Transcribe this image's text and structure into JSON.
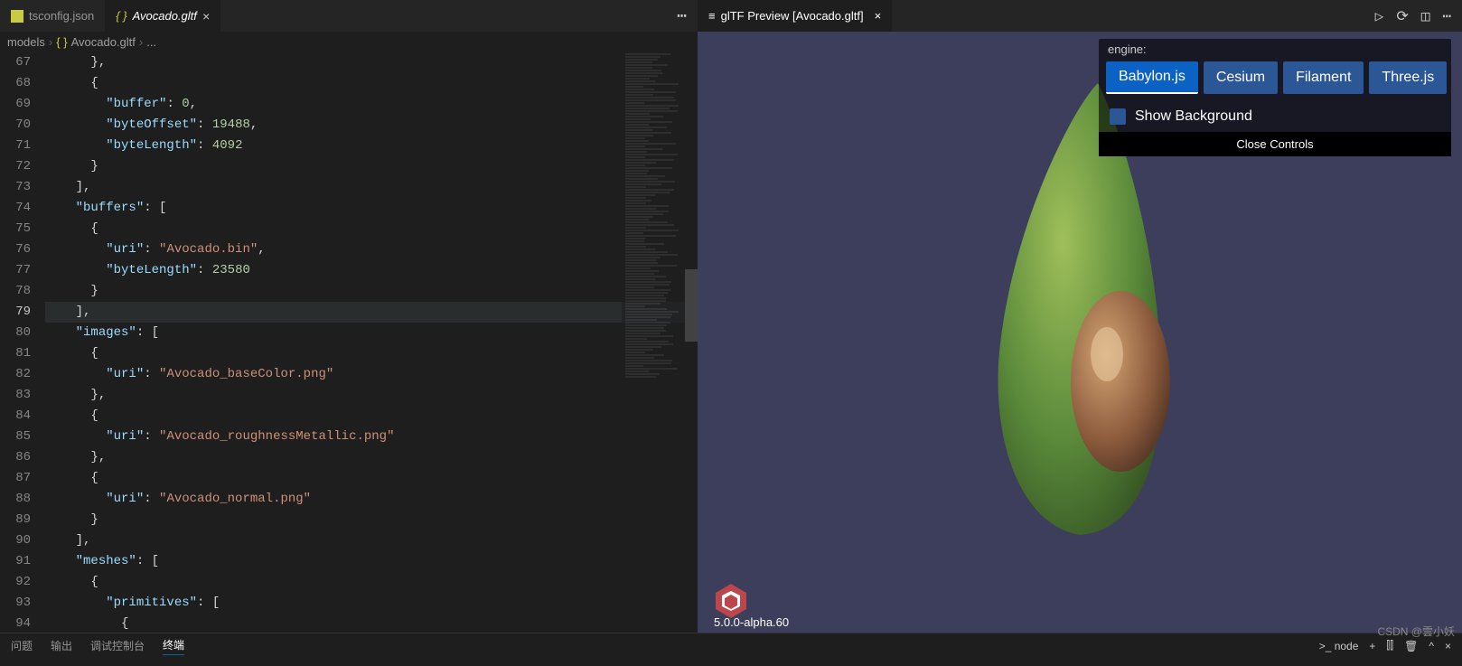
{
  "editor": {
    "tabs": [
      {
        "name": "tsconfig.json",
        "active": false,
        "icon": "json"
      },
      {
        "name": "Avocado.gltf",
        "active": true,
        "icon": "braces"
      }
    ],
    "breadcrumb": {
      "root": "models",
      "file": "Avocado.gltf",
      "more": "..."
    },
    "code": [
      {
        "n": 67,
        "t": [
          [
            "      ",
            "p"
          ],
          [
            "},",
            "p"
          ]
        ]
      },
      {
        "n": 68,
        "t": [
          [
            "      ",
            "p"
          ],
          [
            "{",
            "p"
          ]
        ]
      },
      {
        "n": 69,
        "t": [
          [
            "        ",
            "p"
          ],
          [
            "\"buffer\"",
            "k"
          ],
          [
            ": ",
            "p"
          ],
          [
            "0",
            "n"
          ],
          [
            ",",
            "p"
          ]
        ]
      },
      {
        "n": 70,
        "t": [
          [
            "        ",
            "p"
          ],
          [
            "\"byteOffset\"",
            "k"
          ],
          [
            ": ",
            "p"
          ],
          [
            "19488",
            "n"
          ],
          [
            ",",
            "p"
          ]
        ]
      },
      {
        "n": 71,
        "t": [
          [
            "        ",
            "p"
          ],
          [
            "\"byteLength\"",
            "k"
          ],
          [
            ": ",
            "p"
          ],
          [
            "4092",
            "n"
          ]
        ]
      },
      {
        "n": 72,
        "t": [
          [
            "      ",
            "p"
          ],
          [
            "}",
            "p"
          ]
        ]
      },
      {
        "n": 73,
        "t": [
          [
            "    ",
            "p"
          ],
          [
            "],",
            "p"
          ]
        ]
      },
      {
        "n": 74,
        "t": [
          [
            "    ",
            "p"
          ],
          [
            "\"buffers\"",
            "k"
          ],
          [
            ": [",
            "p"
          ]
        ]
      },
      {
        "n": 75,
        "t": [
          [
            "      ",
            "p"
          ],
          [
            "{",
            "p"
          ]
        ]
      },
      {
        "n": 76,
        "t": [
          [
            "        ",
            "p"
          ],
          [
            "\"uri\"",
            "k"
          ],
          [
            ": ",
            "p"
          ],
          [
            "\"Avocado.bin\"",
            "s"
          ],
          [
            ",",
            "p"
          ]
        ]
      },
      {
        "n": 77,
        "t": [
          [
            "        ",
            "p"
          ],
          [
            "\"byteLength\"",
            "k"
          ],
          [
            ": ",
            "p"
          ],
          [
            "23580",
            "n"
          ]
        ]
      },
      {
        "n": 78,
        "t": [
          [
            "      ",
            "p"
          ],
          [
            "}",
            "p"
          ]
        ]
      },
      {
        "n": 79,
        "t": [
          [
            "    ",
            "p"
          ],
          [
            "],",
            "p"
          ]
        ],
        "hl": true
      },
      {
        "n": 80,
        "t": [
          [
            "    ",
            "p"
          ],
          [
            "\"images\"",
            "k"
          ],
          [
            ": [",
            "p"
          ]
        ]
      },
      {
        "n": 81,
        "t": [
          [
            "      ",
            "p"
          ],
          [
            "{",
            "p"
          ]
        ]
      },
      {
        "n": 82,
        "t": [
          [
            "        ",
            "p"
          ],
          [
            "\"uri\"",
            "k"
          ],
          [
            ": ",
            "p"
          ],
          [
            "\"Avocado_baseColor.png\"",
            "s"
          ]
        ]
      },
      {
        "n": 83,
        "t": [
          [
            "      ",
            "p"
          ],
          [
            "},",
            "p"
          ]
        ]
      },
      {
        "n": 84,
        "t": [
          [
            "      ",
            "p"
          ],
          [
            "{",
            "p"
          ]
        ]
      },
      {
        "n": 85,
        "t": [
          [
            "        ",
            "p"
          ],
          [
            "\"uri\"",
            "k"
          ],
          [
            ": ",
            "p"
          ],
          [
            "\"Avocado_roughnessMetallic.png\"",
            "s"
          ]
        ]
      },
      {
        "n": 86,
        "t": [
          [
            "      ",
            "p"
          ],
          [
            "},",
            "p"
          ]
        ]
      },
      {
        "n": 87,
        "t": [
          [
            "      ",
            "p"
          ],
          [
            "{",
            "p"
          ]
        ]
      },
      {
        "n": 88,
        "t": [
          [
            "        ",
            "p"
          ],
          [
            "\"uri\"",
            "k"
          ],
          [
            ": ",
            "p"
          ],
          [
            "\"Avocado_normal.png\"",
            "s"
          ]
        ]
      },
      {
        "n": 89,
        "t": [
          [
            "      ",
            "p"
          ],
          [
            "}",
            "p"
          ]
        ]
      },
      {
        "n": 90,
        "t": [
          [
            "    ",
            "p"
          ],
          [
            "],",
            "p"
          ]
        ]
      },
      {
        "n": 91,
        "t": [
          [
            "    ",
            "p"
          ],
          [
            "\"meshes\"",
            "k"
          ],
          [
            ": [",
            "p"
          ]
        ]
      },
      {
        "n": 92,
        "t": [
          [
            "      ",
            "p"
          ],
          [
            "{",
            "p"
          ]
        ]
      },
      {
        "n": 93,
        "t": [
          [
            "        ",
            "p"
          ],
          [
            "\"primitives\"",
            "k"
          ],
          [
            ": [",
            "p"
          ]
        ]
      },
      {
        "n": 94,
        "t": [
          [
            "          ",
            "p"
          ],
          [
            "{",
            "p"
          ]
        ]
      }
    ]
  },
  "preview": {
    "tab_title": "glTF Preview [Avocado.gltf]",
    "controls": {
      "label": "engine:",
      "engines": [
        "Babylon.js",
        "Cesium",
        "Filament",
        "Three.js"
      ],
      "active_engine": "Babylon.js",
      "show_bg_label": "Show Background",
      "close_label": "Close Controls"
    },
    "version": "5.0.0-alpha.60"
  },
  "bottom": {
    "tabs": [
      "问题",
      "输出",
      "调试控制台",
      "终端"
    ],
    "active": "终端",
    "node": "node"
  },
  "watermark": "CSDN @雲小妖"
}
